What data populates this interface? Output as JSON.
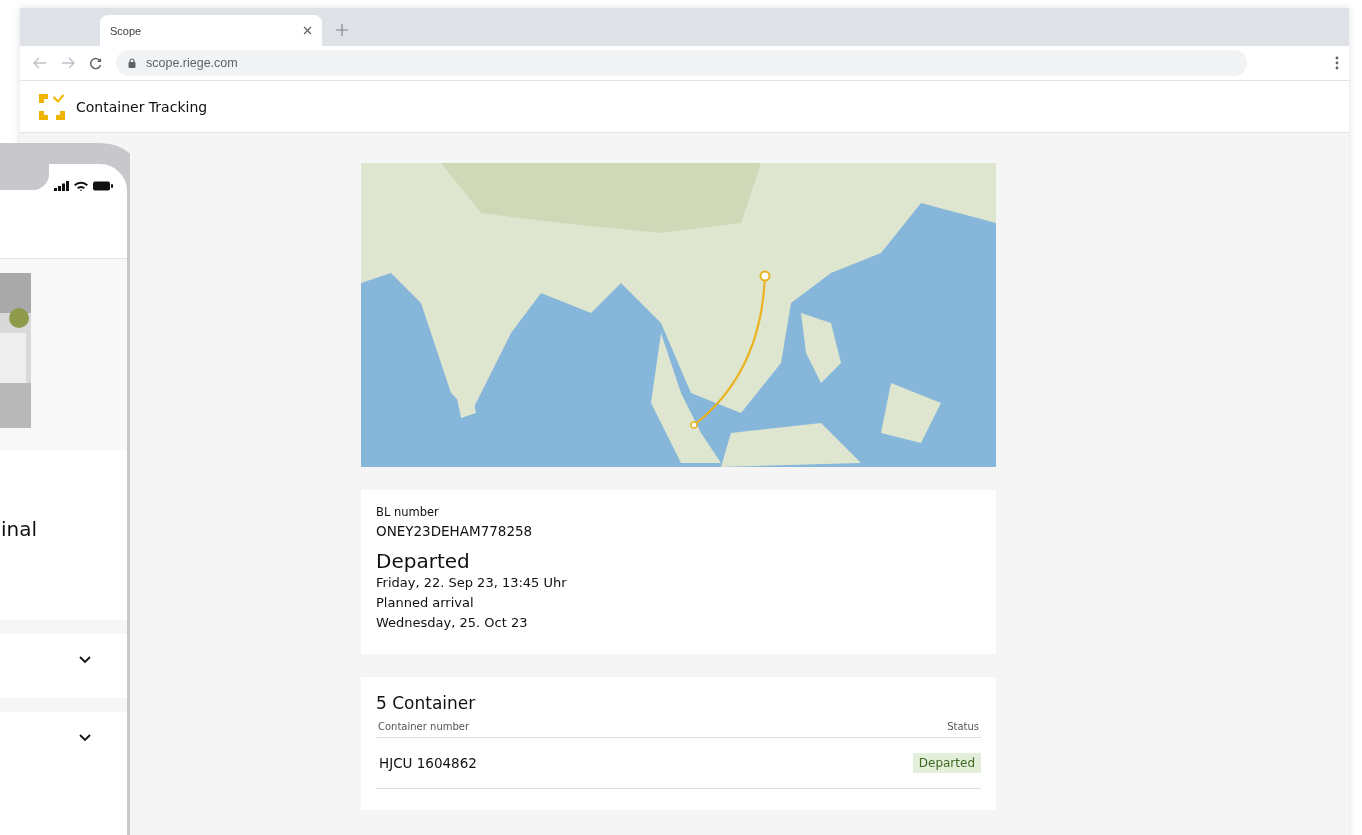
{
  "browser": {
    "tab": {
      "title": "Scope"
    },
    "address": "scope.riege.com"
  },
  "app": {
    "title": "Container Tracking"
  },
  "shipment": {
    "bl_label": "BL number",
    "bl_number": "ONEY23DEHAM778258",
    "status": "Departed",
    "departed_at": "Friday, 22. Sep 23, 13:45 Uhr",
    "planned_label": "Planned arrival",
    "planned_at": "Wednesday, 25. Oct 23"
  },
  "containers": {
    "title": "5 Container",
    "columns": [
      "Container number",
      "Status"
    ],
    "rows": [
      {
        "number": "HJCU 1604862",
        "status": "Departed"
      }
    ]
  },
  "phone": {
    "heading": "inal",
    "sections": [
      {
        "expanded": false
      },
      {
        "expanded": false
      }
    ]
  }
}
